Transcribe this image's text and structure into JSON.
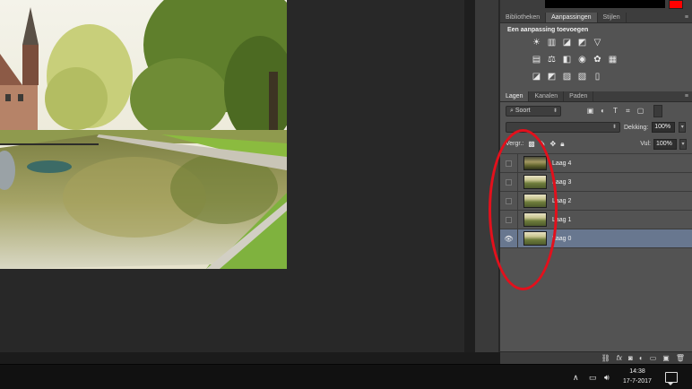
{
  "panels": {
    "top_tabs": [
      {
        "label": "Bibliotheken",
        "active": false
      },
      {
        "label": "Aanpassingen",
        "active": true
      },
      {
        "label": "Stijlen",
        "active": false
      }
    ],
    "adjustments_title": "Een aanpassing toevoegen",
    "adjustment_icons_row1": [
      "brightness-contrast-icon",
      "levels-icon",
      "curves-icon",
      "exposure-icon",
      "vibrance-icon"
    ],
    "adjustment_icons_row2": [
      "hue-saturation-icon",
      "color-balance-icon",
      "black-white-icon",
      "photo-filter-icon",
      "channel-mixer-icon",
      "color-lookup-icon"
    ],
    "adjustment_icons_row3": [
      "invert-icon",
      "posterize-icon",
      "threshold-icon",
      "selective-color-icon",
      "gradient-map-icon"
    ],
    "layers_tabs": [
      {
        "label": "Lagen",
        "active": true
      },
      {
        "label": "Kanalen",
        "active": false
      },
      {
        "label": "Paden",
        "active": false
      }
    ],
    "sort_label": "⌕ Soort",
    "blend_mode": "",
    "opacity_label": "Dekking:",
    "opacity_value": "100%",
    "lock_label": "Vergr.:",
    "fill_label": "Vul:",
    "fill_value": "100%",
    "layers": [
      {
        "name": "Laag 4",
        "visible": false,
        "selected": false
      },
      {
        "name": "Laag 3",
        "visible": false,
        "selected": false
      },
      {
        "name": "Laag 2",
        "visible": false,
        "selected": false
      },
      {
        "name": "Laag 1",
        "visible": false,
        "selected": false
      },
      {
        "name": "Laag 0",
        "visible": true,
        "selected": true
      }
    ]
  },
  "colors": {
    "foreground_swatch": "#ff0000",
    "annotation": "#e3101c",
    "selected_layer": "#68778f"
  },
  "taskbar": {
    "time": "14:38",
    "date": "17-7-2017"
  }
}
